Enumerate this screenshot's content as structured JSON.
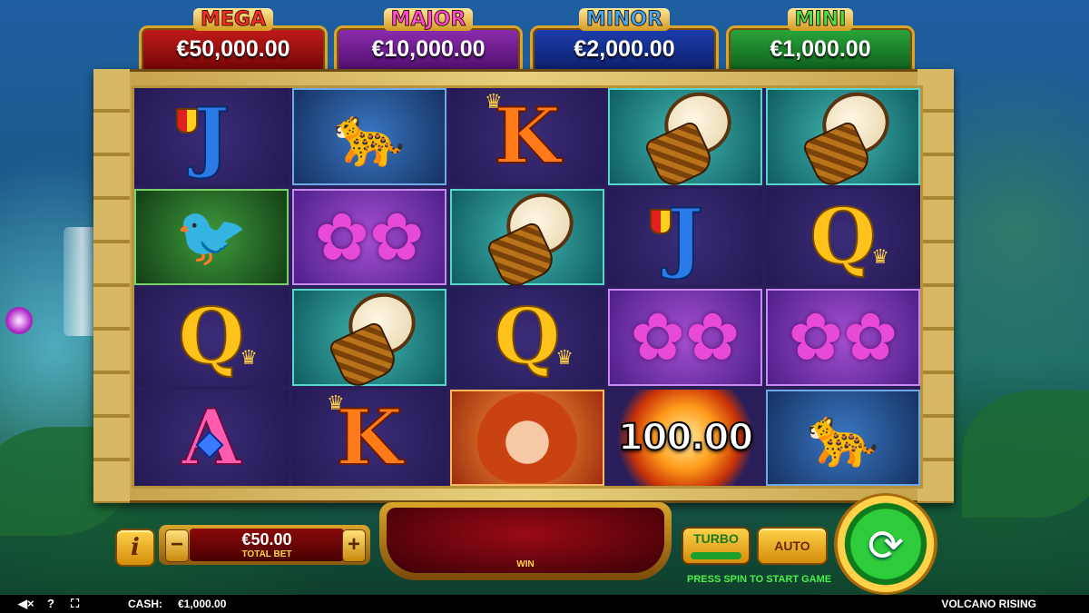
{
  "jackpots": [
    {
      "name": "MEGA",
      "value": "€50,000.00"
    },
    {
      "name": "MAJOR",
      "value": "€10,000.00"
    },
    {
      "name": "MINOR",
      "value": "€2,000.00"
    },
    {
      "name": "MINI",
      "value": "€1,000.00"
    }
  ],
  "reels": [
    [
      "J",
      "Jaguar",
      "K",
      "Drum",
      "Drum"
    ],
    [
      "Toucan",
      "Orchid",
      "Drum",
      "J",
      "Q"
    ],
    [
      "Q",
      "Drum",
      "Q",
      "Orchid",
      "Orchid"
    ],
    [
      "A",
      "K",
      "Goddess",
      "Fireball",
      "Jaguar"
    ]
  ],
  "fireball_value": "100.00",
  "controls": {
    "info_label": "i",
    "bet_minus": "−",
    "bet_plus": "+",
    "total_bet_value": "€50.00",
    "total_bet_label": "TOTAL BET",
    "win_label": "WIN",
    "turbo_label": "TURBO",
    "auto_label": "AUTO",
    "spin_icon": "⟳",
    "press_spin_text": "PRESS SPIN TO START GAME"
  },
  "status_bar": {
    "sound_icon": "speaker-muted-icon",
    "help_icon": "?",
    "fullscreen_icon": "fullscreen-icon",
    "cash_label": "CASH:",
    "cash_value": "€1,000.00",
    "game_name": "VOLCANO RISING"
  }
}
